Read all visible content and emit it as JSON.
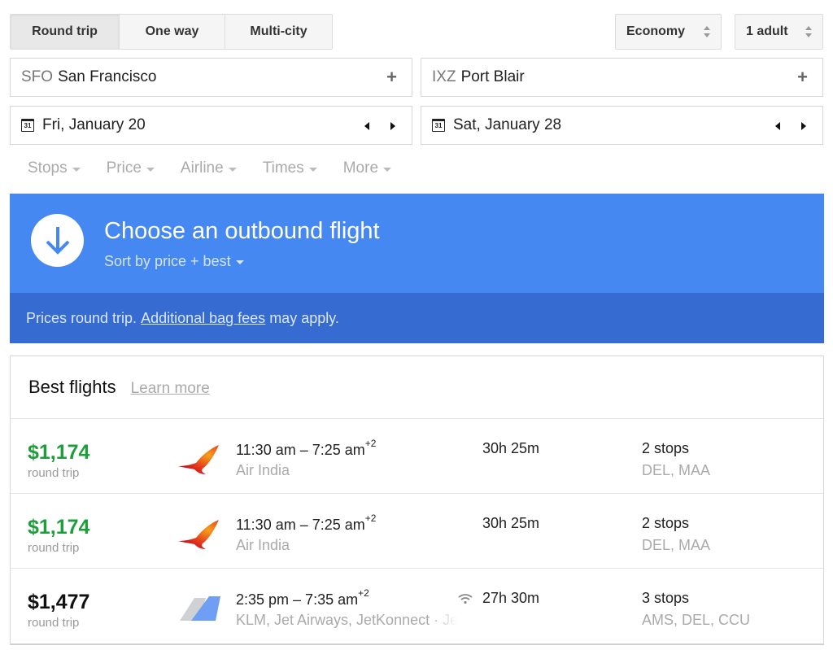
{
  "trip_type": {
    "options": [
      "Round trip",
      "One way",
      "Multi-city"
    ],
    "selected": "Round trip"
  },
  "cabin": {
    "value": "Economy",
    "icon": "updown-arrows-icon"
  },
  "passengers": {
    "value": "1 adult",
    "icon": "updown-arrows-icon"
  },
  "origin": {
    "code": "SFO",
    "city": "San Francisco",
    "icon": "plus-icon"
  },
  "destination": {
    "code": "IXZ",
    "city": "Port Blair",
    "icon": "plus-icon"
  },
  "departure_date": {
    "value": "Fri, January 20",
    "calendar_day": "31",
    "icon": "calendar-icon"
  },
  "return_date": {
    "value": "Sat, January 28",
    "calendar_day": "31",
    "icon": "calendar-icon"
  },
  "filters": [
    "Stops",
    "Price",
    "Airline",
    "Times",
    "More"
  ],
  "banner": {
    "icon": "arrow-down-circle-icon",
    "title": "Choose an outbound flight",
    "sort_label": "Sort by price + best",
    "note_prefix": "Prices round trip. ",
    "note_link": "Additional bag fees",
    "note_suffix": " may apply.",
    "colors": {
      "primary": "#4688f1",
      "secondary": "#366cd2"
    }
  },
  "results": {
    "title": "Best flights",
    "learn_more": "Learn more",
    "flights": [
      {
        "price": "$1,174",
        "price_color": "green",
        "price_sub": "round trip",
        "logo": "air-india-logo",
        "times": "11:30 am – 7:25 am",
        "day_offset": "+2",
        "airline": "Air India",
        "airline_extra": "",
        "wifi": false,
        "duration": "30h 25m",
        "stops": "2 stops",
        "stops_detail": "DEL, MAA"
      },
      {
        "price": "$1,174",
        "price_color": "green",
        "price_sub": "round trip",
        "logo": "air-india-logo",
        "times": "11:30 am – 7:25 am",
        "day_offset": "+2",
        "airline": "Air India",
        "airline_extra": "",
        "wifi": false,
        "duration": "30h 25m",
        "stops": "2 stops",
        "stops_detail": "DEL, MAA"
      },
      {
        "price": "$1,477",
        "price_color": "black",
        "price_sub": "round trip",
        "logo": "multi-airline-logo",
        "times": "2:35 pm – 7:35 am",
        "day_offset": "+2",
        "airline": "KLM, Jet Airways, JetKonnect",
        "airline_extra": " · Je",
        "wifi": true,
        "duration": "27h 30m",
        "stops": "3 stops",
        "stops_detail": "AMS, DEL, CCU"
      }
    ]
  },
  "colors": {
    "price_good": "#1e9e3a",
    "muted_text": "#aaaaaa"
  }
}
